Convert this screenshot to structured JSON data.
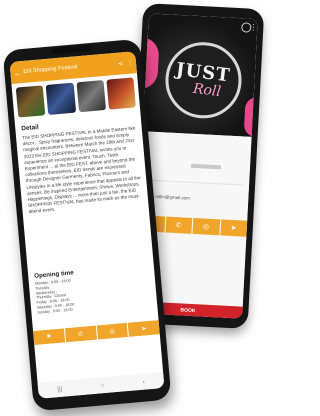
{
  "back_phone": {
    "hero_word_1": "JUST",
    "hero_word_2": "Roll",
    "email_text": "rollin@gmail.com",
    "bar_icons": [
      "bookmark-icon",
      "phone-icon",
      "globe-icon",
      "send-icon"
    ],
    "book_label": "BOOK"
  },
  "front_phone": {
    "header": {
      "back_icon": "←",
      "title": "Eid Shopping Festival",
      "share_icon": "⋖",
      "more_icon": "⋮"
    },
    "gallery": [
      "thumbnail-1",
      "thumbnail-2",
      "thumbnail-3",
      "thumbnail-4"
    ],
    "detail": {
      "title": "Detail",
      "text": "The EID SHOPPING FESTIVAL in a Middle Eastern like décor... Spicy fragrances, delicious foods and simply magical encounters. Between March the 18th and 21st 2022 the EID SHOPPING FESTIVAL invites you to experience an exceptional event. Touch, Taste, Experiment ... at the EID FEST, above and beyond the collections themselves, EID trends are expressed through Designer Garments, Fabrics, Flavours and Lifestyles in a life style experience that appeals to all the senses. Be inspired Entertainment, Shows, Workshops, Happenings, Displays ... more than just a fair, the EID SHOPPING FESTIVAL has made its mark as the must-attend event."
    },
    "opening": {
      "title": "Opening time",
      "lines": [
        "Monday : 9:00 - 18:00",
        "Tuesday :",
        "Wednesday :",
        "Thursday : Closed",
        "Friday : 9:00 - 18:00",
        "Saturday : 9:00 - 18:00",
        "Sunday : 9:00 - 18:00"
      ]
    },
    "bottom_bar_icons": [
      "■",
      "✆",
      "◎",
      "➤"
    ],
    "nav_icons": [
      "|||",
      "○",
      "‹"
    ]
  }
}
